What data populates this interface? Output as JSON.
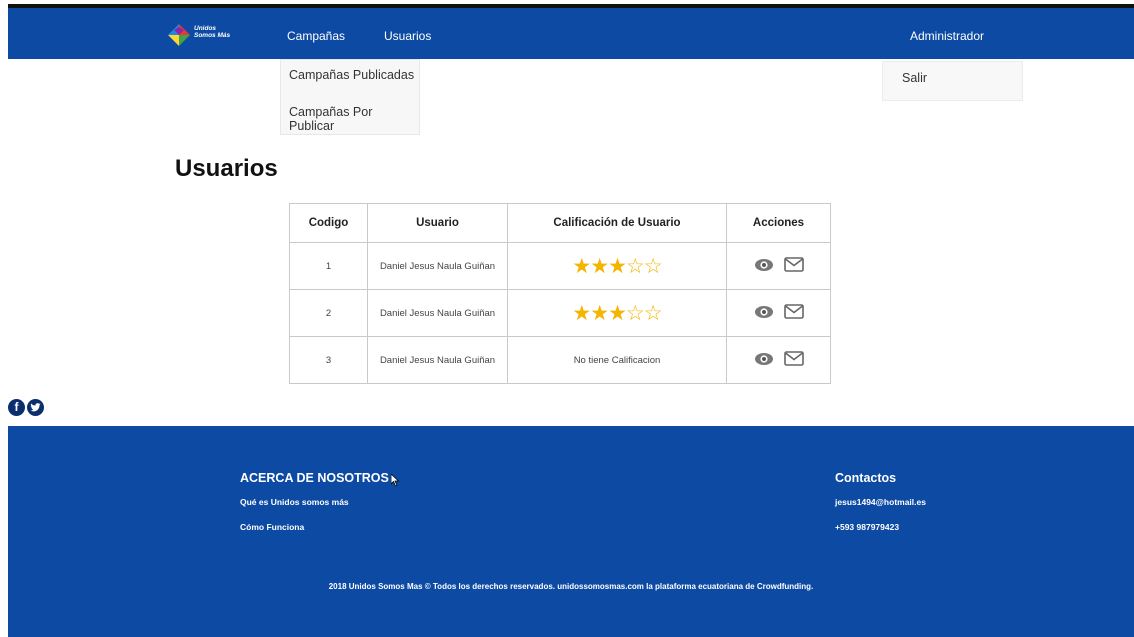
{
  "navbar": {
    "logo_text_line1": "Unidos",
    "logo_text_line2": "Somos Más",
    "links": [
      {
        "label": "Campañas"
      },
      {
        "label": "Usuarios"
      }
    ],
    "user_label": "Administrador",
    "dropdown": [
      {
        "label": "Campañas Publicadas"
      },
      {
        "label": "Campañas Por Publicar"
      }
    ],
    "user_menu": {
      "logout": "Salir"
    }
  },
  "page": {
    "title": "Usuarios"
  },
  "table": {
    "headers": [
      "Codigo",
      "Usuario",
      "Calificación de Usuario",
      "Acciones"
    ],
    "rows": [
      {
        "codigo": "1",
        "usuario": "Daniel Jesus Naula Guiñan",
        "rating": 3,
        "rating_text": ""
      },
      {
        "codigo": "2",
        "usuario": "Daniel Jesus Naula Guiñan",
        "rating": 3,
        "rating_text": ""
      },
      {
        "codigo": "3",
        "usuario": "Daniel Jesus Naula Guiñan",
        "rating": 0,
        "rating_text": "No tiene Calificacion"
      }
    ],
    "rating_max": 5,
    "action_icons": [
      "eye-icon",
      "mail-icon"
    ]
  },
  "social": {
    "icons": [
      "facebook-icon",
      "twitter-icon"
    ]
  },
  "footer": {
    "about_title": "ACERCA DE NOSOTROS",
    "about_links": [
      "Qué es Unidos somos más",
      "Cómo Funciona"
    ],
    "contact_title": "Contactos",
    "contact_email": "jesus1494@hotmail.es",
    "contact_phone": "+593 987979423",
    "copyright": "2018 Unidos Somos Mas © Todos los derechos reservados. unidossomosmas.com la plataforma ecuatoriana de Crowdfunding."
  },
  "colors": {
    "brand_blue": "#0d4aa3",
    "star": "#f4b400"
  }
}
